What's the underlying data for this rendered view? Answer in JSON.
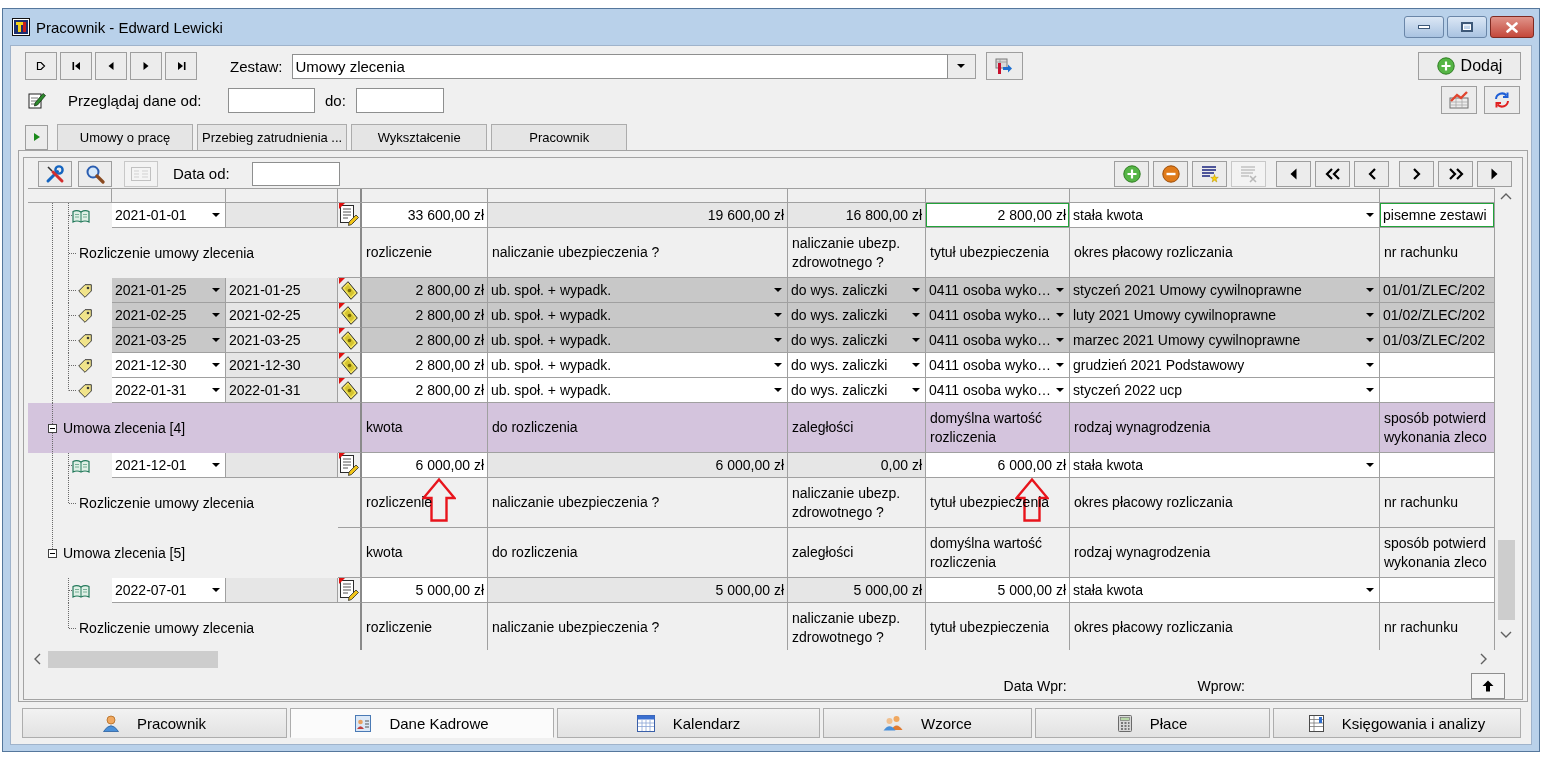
{
  "window": {
    "title": "Pracownik - Edward Lewicki"
  },
  "record_nav": {
    "set_label": "Zestaw:",
    "set_value": "Umowy zlecenia",
    "add_button": "Dodaj",
    "range_label": "Przeglądaj dane od:",
    "range_to_label": "do:"
  },
  "tabs": [
    {
      "label": "Umowy o pracę"
    },
    {
      "label": "Przebieg zatrudnienia ..."
    },
    {
      "label": "Wykształcenie"
    },
    {
      "label": "Pracownik"
    }
  ],
  "panel_toolbar": {
    "left_buttons": [
      {
        "kind": "tools",
        "disabled": false
      },
      {
        "kind": "search",
        "disabled": false
      },
      {
        "kind": "card",
        "disabled": true
      }
    ],
    "date_label": "Data od:",
    "right_buttons": [
      {
        "kind": "add",
        "disabled": false
      },
      {
        "kind": "remove",
        "disabled": false
      },
      {
        "kind": "mark-list",
        "disabled": false
      },
      {
        "kind": "clear-list",
        "disabled": true
      },
      {
        "kind": "first",
        "disabled": false
      },
      {
        "kind": "page-back",
        "disabled": false
      },
      {
        "kind": "back",
        "disabled": false
      },
      {
        "kind": "forward",
        "disabled": false
      },
      {
        "kind": "page-forward",
        "disabled": false
      },
      {
        "kind": "last",
        "disabled": false
      }
    ]
  },
  "grid": {
    "groups": [
      {
        "children": [
          {
            "kind": "contract",
            "outlined": true,
            "date": "2021-01-01",
            "amount": "33 600,00 zł",
            "to_settle": "19 600,00 zł",
            "arrears": "16 800,00 zł",
            "default_value": "2 800,00 zł",
            "pay_type": "stała kwota",
            "confirmation": "pisemne zestawi"
          },
          {
            "kind": "settlements",
            "label": "Rozliczenie umowy zlecenia",
            "headers": [
              "rozliczenie",
              "naliczanie ubezpieczenia ?",
              "naliczanie ubezp. zdrowotnego ?",
              "tytuł ubezpieczenia",
              "okres płacowy rozliczania",
              "nr rachunku"
            ],
            "children": [
              {
                "locked": true,
                "date": "2021-01-25",
                "date_to": "2021-01-25",
                "amount": "2 800,00 zł",
                "social": "ub. społ. + wypadk.",
                "health": "do wys. zaliczki",
                "insurance_title": "0411 osoba wyko…",
                "period": "styczeń 2021 Umowy cywilnoprawne",
                "account": "01/01/ZLEC/202"
              },
              {
                "locked": true,
                "date": "2021-02-25",
                "date_to": "2021-02-25",
                "amount": "2 800,00 zł",
                "social": "ub. społ. + wypadk.",
                "health": "do wys. zaliczki",
                "insurance_title": "0411 osoba wyko…",
                "period": "luty 2021 Umowy cywilnoprawne",
                "account": "01/02/ZLEC/202"
              },
              {
                "locked": true,
                "date": "2021-03-25",
                "date_to": "2021-03-25",
                "amount": "2 800,00 zł",
                "social": "ub. społ. + wypadk.",
                "health": "do wys. zaliczki",
                "insurance_title": "0411 osoba wyko…",
                "period": "marzec 2021 Umowy cywilnoprawne",
                "account": "01/03/ZLEC/202"
              },
              {
                "locked": false,
                "date": "2021-12-30",
                "date_to": "2021-12-30",
                "amount": "2 800,00 zł",
                "social": "ub. społ. + wypadk.",
                "health": "do wys. zaliczki",
                "insurance_title": "0411 osoba wyko…",
                "period": "grudzień 2021 Podstawowy"
              },
              {
                "locked": false,
                "date": "2022-01-31",
                "date_to": "2022-01-31",
                "amount": "2 800,00 zł",
                "social": "ub. społ. + wypadk.",
                "health": "do wys. zaliczki",
                "insurance_title": "0411 osoba wyko…",
                "period": "styczeń 2022 ucp"
              }
            ]
          }
        ]
      },
      {
        "label": "Umowa zlecenia [4]",
        "selected": true,
        "expanded": true,
        "headers": [
          "kwota",
          "do rozliczenia",
          "zaległości",
          "domyślna wartość rozliczenia",
          "rodzaj wynagrodzenia",
          "sposób potwierd wykonania zleco"
        ],
        "children": [
          {
            "kind": "contract",
            "outlined": false,
            "date": "2021-12-01",
            "amount": "6 000,00 zł",
            "to_settle": "6 000,00 zł",
            "arrears": "0,00 zł",
            "default_value": "6 000,00 zł",
            "pay_type": "stała kwota"
          },
          {
            "kind": "settlements",
            "label": "Rozliczenie umowy zlecenia",
            "headers": [
              "rozliczenie",
              "naliczanie ubezpieczenia ?",
              "naliczanie ubezp. zdrowotnego ?",
              "tytuł ubezpieczenia",
              "okres płacowy rozliczania",
              "nr rachunku"
            ]
          }
        ]
      },
      {
        "label": "Umowa zlecenia [5]",
        "selected": false,
        "expanded": true,
        "headers": [
          "kwota",
          "do rozliczenia",
          "zaległości",
          "domyślna wartość rozliczenia",
          "rodzaj wynagrodzenia",
          "sposób potwierd wykonania zleco"
        ],
        "children": [
          {
            "kind": "contract",
            "outlined": false,
            "date": "2022-07-01",
            "amount": "5 000,00 zł",
            "to_settle": "5 000,00 zł",
            "arrears": "5 000,00 zł",
            "default_value": "5 000,00 zł",
            "pay_type": "stała kwota"
          },
          {
            "kind": "settlements",
            "label": "Rozliczenie umowy zlecenia",
            "headers": [
              "rozliczenie",
              "naliczanie ubezpieczenia ?",
              "naliczanie ubezp. zdrowotnego ?",
              "tytuł ubezpieczenia",
              "okres płacowy rozliczania",
              "nr rachunku"
            ]
          }
        ]
      }
    ]
  },
  "footer": {
    "date_label": "Data Wpr:",
    "user_label": "Wprow:"
  },
  "modules": [
    {
      "kind": "person",
      "label": "Pracownik",
      "selected": false
    },
    {
      "kind": "id-card",
      "label": "Dane Kadrowe",
      "selected": true
    },
    {
      "kind": "calendar",
      "label": "Kalendarz",
      "selected": false
    },
    {
      "kind": "people",
      "label": "Wzorce",
      "selected": false
    },
    {
      "kind": "calculator",
      "label": "Płace",
      "selected": false
    },
    {
      "kind": "ledger",
      "label": "Księgowania i analizy",
      "selected": false
    }
  ]
}
